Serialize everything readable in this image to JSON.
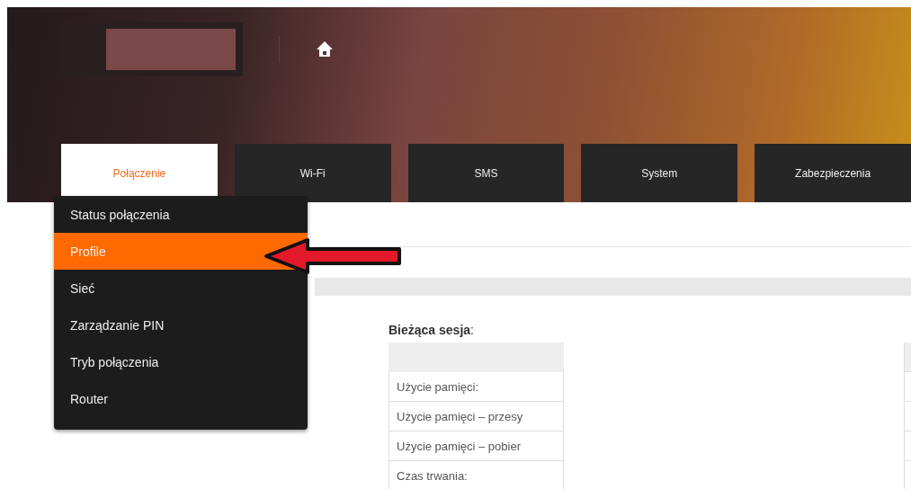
{
  "tabs": [
    {
      "label": "Połączenie",
      "selected": true
    },
    {
      "label": "Wi-Fi",
      "selected": false
    },
    {
      "label": "SMS",
      "selected": false
    },
    {
      "label": "System",
      "selected": false
    },
    {
      "label": "Zabezpieczenia",
      "selected": false
    }
  ],
  "menu": {
    "items": [
      {
        "label": "Status połączenia",
        "selected": false
      },
      {
        "label": "Profile",
        "selected": true
      },
      {
        "label": "Sieć",
        "selected": false
      },
      {
        "label": "Zarządzanie PIN",
        "selected": false
      },
      {
        "label": "Tryb połączenia",
        "selected": false
      },
      {
        "label": "Router",
        "selected": false
      }
    ]
  },
  "session": {
    "title": "Bieżąca sesja",
    "title_suffix": ":",
    "rows": [
      "Użycie pamięci:",
      "Użycie pamięci – przesy",
      "Użycie pamięci – pobier",
      "Czas trwania:"
    ]
  }
}
